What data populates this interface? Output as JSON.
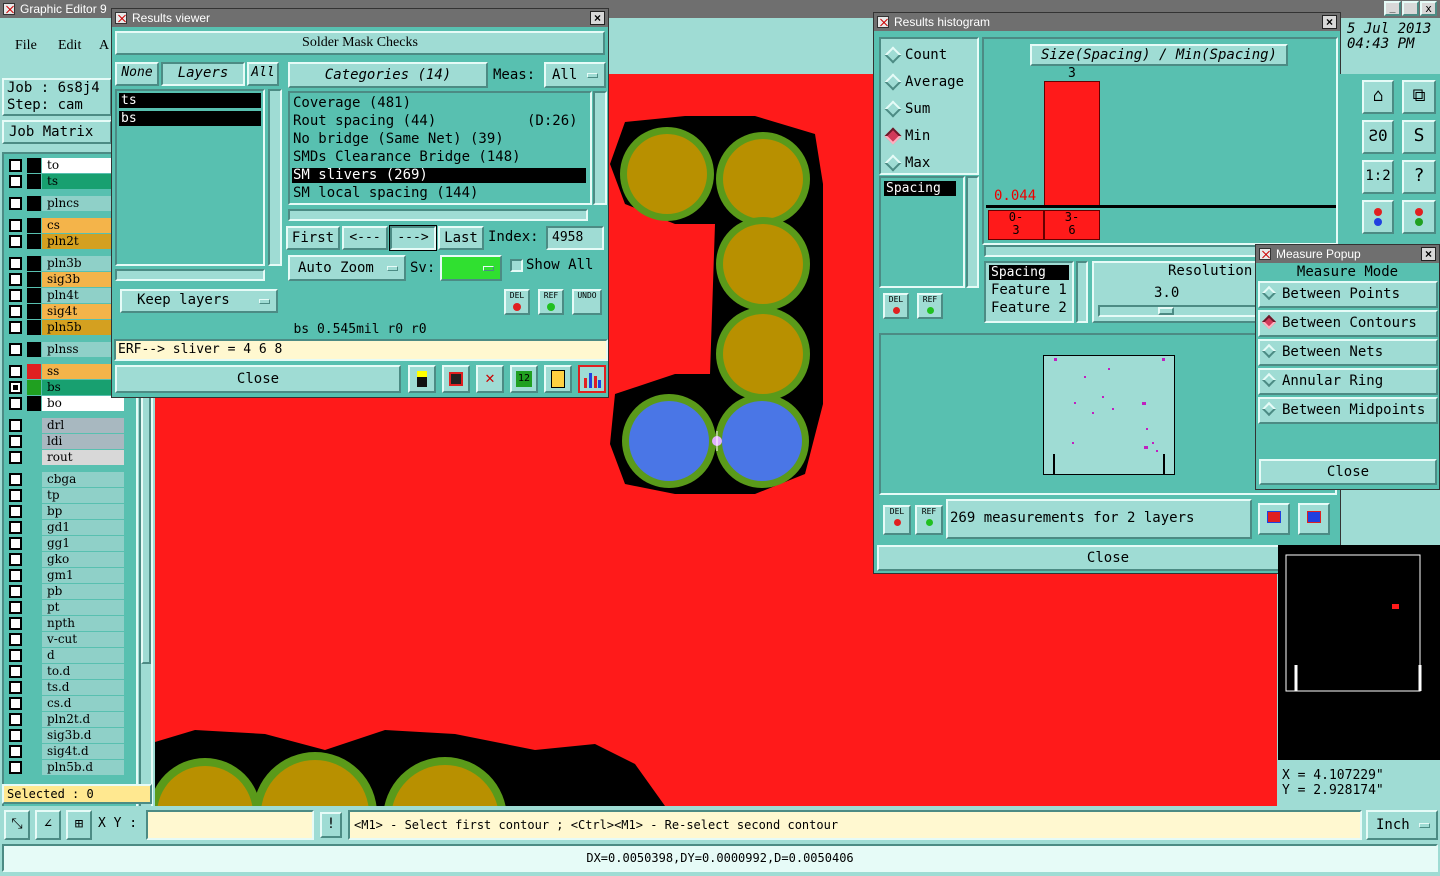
{
  "app": {
    "title": "Graphic Editor 9",
    "date": "5 Jul 2013",
    "time": "04:43 PM"
  },
  "menu": {
    "file": "File",
    "edit": "Edit",
    "action": "A"
  },
  "job": {
    "job_label": "Job : 6s8j4",
    "step_label": "Step: cam",
    "job_matrix": "Job Matrix"
  },
  "layers": [
    {
      "name": "to",
      "color": "#ffffff",
      "checked": false
    },
    {
      "name": "ts",
      "color": "#18a070",
      "checked": false
    },
    {
      "name": "plncs",
      "color": "#8fd0c8",
      "checked": false
    },
    {
      "name": "cs",
      "color": "#f4b44a",
      "checked": false
    },
    {
      "name": "pln2t",
      "color": "#d4a020",
      "checked": false
    },
    {
      "name": "pln3b",
      "color": "#8fd0c8",
      "checked": false
    },
    {
      "name": "sig3b",
      "color": "#f4b44a",
      "checked": false
    },
    {
      "name": "pln4t",
      "color": "#8fd0c8",
      "checked": false
    },
    {
      "name": "sig4t",
      "color": "#f4b44a",
      "checked": false
    },
    {
      "name": "pln5b",
      "color": "#d4a020",
      "checked": false
    },
    {
      "name": "plnss",
      "color": "#8fd0c8",
      "checked": false
    },
    {
      "name": "ss",
      "color": "#f4b44a",
      "checked": false
    },
    {
      "name": "bs",
      "color": "#18a070",
      "checked": true
    },
    {
      "name": "bo",
      "color": "#ffffff",
      "checked": false
    },
    {
      "name": "drl",
      "color": "#a8b8c0",
      "checked": false
    },
    {
      "name": "ldi",
      "color": "#a8b8c0",
      "checked": false
    },
    {
      "name": "rout",
      "color": "#d8d8d8",
      "checked": false
    },
    {
      "name": "cbga",
      "color": "#8fd0c8",
      "checked": false
    },
    {
      "name": "tp",
      "color": "#8fd0c8",
      "checked": false
    },
    {
      "name": "bp",
      "color": "#8fd0c8",
      "checked": false
    },
    {
      "name": "gd1",
      "color": "#8fd0c8",
      "checked": false
    },
    {
      "name": "gg1",
      "color": "#8fd0c8",
      "checked": false
    },
    {
      "name": "gko",
      "color": "#8fd0c8",
      "checked": false
    },
    {
      "name": "gm1",
      "color": "#8fd0c8",
      "checked": false
    },
    {
      "name": "pb",
      "color": "#8fd0c8",
      "checked": false
    },
    {
      "name": "pt",
      "color": "#8fd0c8",
      "checked": false
    },
    {
      "name": "npth",
      "color": "#8fd0c8",
      "checked": false
    },
    {
      "name": "v-cut",
      "color": "#8fd0c8",
      "checked": false
    },
    {
      "name": "d",
      "color": "#8fd0c8",
      "checked": false
    },
    {
      "name": "to.d",
      "color": "#8fd0c8",
      "checked": false
    },
    {
      "name": "ts.d",
      "color": "#8fd0c8",
      "checked": false
    },
    {
      "name": "cs.d",
      "color": "#8fd0c8",
      "checked": false
    },
    {
      "name": "pln2t.d",
      "color": "#8fd0c8",
      "checked": false
    },
    {
      "name": "sig3b.d",
      "color": "#8fd0c8",
      "checked": false
    },
    {
      "name": "sig4t.d",
      "color": "#8fd0c8",
      "checked": false
    },
    {
      "name": "pln5b.d",
      "color": "#8fd0c8",
      "checked": false
    }
  ],
  "layer_swatches": {
    "to": "#000000",
    "ts": "#000000",
    "plncs": "#000000",
    "cs": "#000000",
    "pln2t": "#000000",
    "pln3b": "#000000",
    "sig3b": "#000000",
    "pln4t": "#000000",
    "sig4t": "#000000",
    "pln5b": "#000000",
    "plnss": "#000000",
    "ss": "#e02020",
    "bs": "#20a020",
    "bo": "#000000"
  },
  "selected_count": "Selected : 0",
  "results_viewer": {
    "title": "Results viewer",
    "header": "Solder Mask Checks",
    "layer_tabs": {
      "none": "None",
      "layers": "Layers",
      "all": "All"
    },
    "layer_list": [
      "ts",
      "bs"
    ],
    "categories_label": "Categories (14)",
    "meas_label": "Meas:",
    "meas_value": "All",
    "categories": [
      {
        "text": "Coverage (481)",
        "extra": "",
        "selected": false
      },
      {
        "text": "Rout spacing (44)",
        "extra": "(D:26)",
        "selected": false
      },
      {
        "text": "No bridge (Same Net) (39)",
        "extra": "",
        "selected": false
      },
      {
        "text": "SMDs Clearance Bridge (148)",
        "extra": "",
        "selected": false
      },
      {
        "text": "SM slivers (269)",
        "extra": "",
        "selected": true
      },
      {
        "text": "SM local spacing (144)",
        "extra": "",
        "selected": false
      }
    ],
    "nav": {
      "first": "First",
      "prev": "<---",
      "next": "--->",
      "last": "Last",
      "index_label": "Index:",
      "index_value": "4958"
    },
    "zoom_mode": "Auto Zoom",
    "sv_label": "Sv:",
    "show_all": "Show All",
    "keep_layers": "Keep layers",
    "del": "DEL",
    "ref": "REF",
    "undo": "UNDO",
    "status_line": "bs 0.545mil  r0  r0",
    "erf_line": "ERF--> sliver = 4 6 8",
    "close": "Close"
  },
  "histogram": {
    "title": "Results histogram",
    "modes": [
      {
        "label": "Count",
        "selected": false
      },
      {
        "label": "Average",
        "selected": false
      },
      {
        "label": "Sum",
        "selected": false
      },
      {
        "label": "Min",
        "selected": true
      },
      {
        "label": "Max",
        "selected": false
      }
    ],
    "spacing_item": "Spacing",
    "chart_title": "Size(Spacing) / Min(Spacing)",
    "bar_count_label": "3",
    "min_value_label": "0.044",
    "bins": [
      "0-\n3",
      "3-\n6"
    ],
    "feature_list": [
      "Spacing",
      "Feature 1",
      "Feature 2"
    ],
    "resolution_label": "Resolution",
    "resolution_value": "3.0",
    "summary": "269 measurements for 2 layers",
    "close": "Close",
    "del": "DEL",
    "ref": "REF"
  },
  "measure_popup": {
    "title": "Measure Popup",
    "header": "Measure Mode",
    "modes": [
      {
        "label": "Between Points",
        "selected": false
      },
      {
        "label": "Between Contours",
        "selected": true
      },
      {
        "label": "Between Nets",
        "selected": false
      },
      {
        "label": "Annular Ring",
        "selected": false
      },
      {
        "label": "Between Midpoints",
        "selected": false
      }
    ],
    "close": "Close"
  },
  "coords": {
    "x": "X = 4.107229\"",
    "y": "Y = 2.928174\""
  },
  "bottom": {
    "xy_label": "X Y :",
    "xy_value": "",
    "hint": "<M1> - Select first contour ; <Ctrl><M1> - Re-select second contour",
    "units": "Inch",
    "status": "DX=0.0050398,DY=0.0000992,D=0.0050406"
  },
  "icons": {
    "right_toolbar": [
      "arrow-icon",
      "house-icon",
      "window-icon",
      "reverse-icon",
      "s-shape-icon",
      "scale-icon",
      "help-icon",
      "layer-icon",
      "layer2-icon"
    ]
  }
}
